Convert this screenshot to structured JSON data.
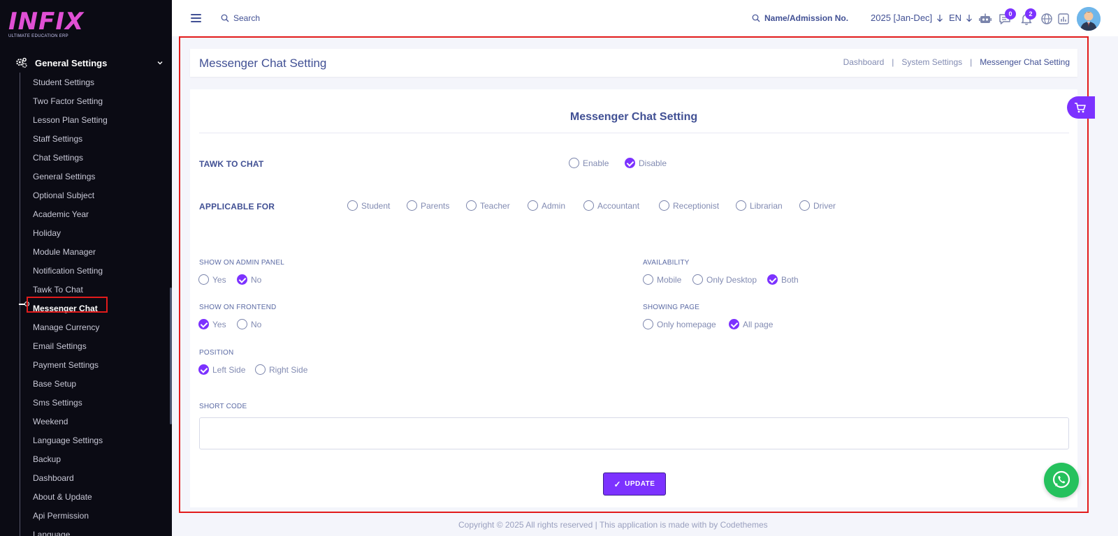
{
  "logo": {
    "text": "INFIX",
    "tagline": "ULTIMATE EDUCATION ERP"
  },
  "sidebar": {
    "group_label": "General Settings",
    "items": [
      "Student Settings",
      "Two Factor Setting",
      "Lesson Plan Setting",
      "Staff Settings",
      "Chat Settings",
      "General Settings",
      "Optional Subject",
      "Academic Year",
      "Holiday",
      "Module Manager",
      "Notification Setting",
      "Tawk To Chat",
      "Messenger Chat",
      "Manage Currency",
      "Email Settings",
      "Payment Settings",
      "Base Setup",
      "Sms Settings",
      "Weekend",
      "Language Settings",
      "Backup",
      "Dashboard",
      "About & Update",
      "Api Permission",
      "Language"
    ],
    "active_item": "Messenger Chat"
  },
  "header": {
    "search_label": "Search",
    "student_search_label": "Name/Admission No.",
    "year": "2025 [Jan-Dec]",
    "language": "EN",
    "chat_badge": "0",
    "notification_badge": "2"
  },
  "page": {
    "title": "Messenger Chat Setting",
    "breadcrumb": [
      "Dashboard",
      "System Settings",
      "Messenger Chat Setting"
    ],
    "breadcrumb_sep": "|"
  },
  "form": {
    "card_title": "Messenger Chat Setting",
    "tawk_label": "TAWK TO CHAT",
    "tawk_options": {
      "enable": "Enable",
      "disable": "Disable"
    },
    "applicable_label": "APPLICABLE FOR",
    "applicable_options": [
      "Student",
      "Parents",
      "Teacher",
      "Admin",
      "Accountant",
      "Receptionist",
      "Librarian",
      "Driver"
    ],
    "admin_panel_label": "SHOW ON ADMIN PANEL",
    "admin_panel_options": {
      "yes": "Yes",
      "no": "No"
    },
    "availability_label": "AVAILABILITY",
    "availability_options": {
      "mobile": "Mobile",
      "desktop": "Only Desktop",
      "both": "Both"
    },
    "frontend_label": "SHOW ON FRONTEND",
    "frontend_options": {
      "yes": "Yes",
      "no": "No"
    },
    "showing_page_label": "SHOWING PAGE",
    "showing_page_options": {
      "home": "Only homepage",
      "all": "All page"
    },
    "position_label": "POSITION",
    "position_options": {
      "left": "Left Side",
      "right": "Right Side"
    },
    "short_code_label": "SHORT CODE",
    "short_code_value": "",
    "update_label": "UPDATE",
    "selected": {
      "tawk": "Disable",
      "admin_panel": "No",
      "availability": "Both",
      "frontend": "Yes",
      "showing_page": "All page",
      "position": "Left Side"
    }
  },
  "footer": {
    "text": "Copyright © 2025 All rights reserved | This application is made with by Codethemes"
  },
  "colors": {
    "accent": "#7c32ff",
    "sidebar_bg": "#0b0b14",
    "text": "#415094",
    "highlight": "#e21b1b",
    "whatsapp": "#25c15d"
  },
  "icons": [
    "menu-icon",
    "search-icon",
    "robot-icon",
    "chat-icon",
    "bell-icon",
    "globe-icon",
    "report-icon",
    "gear-icon",
    "chevron-down-icon",
    "cart-icon",
    "whatsapp-icon"
  ]
}
